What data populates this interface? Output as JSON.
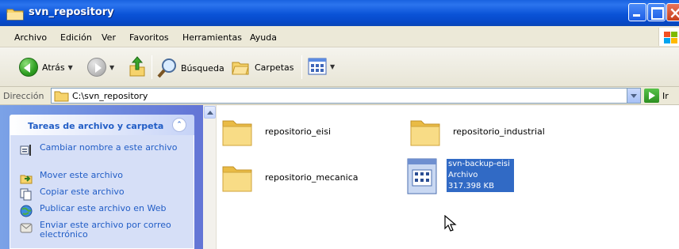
{
  "window": {
    "title": "svn_repository"
  },
  "menu": {
    "items": [
      "Archivo",
      "Edición",
      "Ver",
      "Favoritos",
      "Herramientas",
      "Ayuda"
    ]
  },
  "toolbar": {
    "back_label": "Atrás",
    "search_label": "Búsqueda",
    "folders_label": "Carpetas"
  },
  "address": {
    "label": "Dirección",
    "path": "C:\\svn_repository",
    "go_label": "Ir"
  },
  "tasks": {
    "header": "Tareas de archivo y carpeta",
    "items": [
      {
        "label": "Cambiar nombre a este archivo",
        "icon": "rename-icon"
      },
      {
        "label": "Mover este archivo",
        "icon": "move-icon"
      },
      {
        "label": "Copiar este archivo",
        "icon": "copy-icon"
      },
      {
        "label": "Publicar este archivo en Web",
        "icon": "web-publish-icon"
      },
      {
        "label": "Enviar este archivo por correo electrónico",
        "icon": "email-icon"
      }
    ]
  },
  "files": [
    {
      "name": "repositorio_eisi",
      "type": "folder"
    },
    {
      "name": "repositorio_industrial",
      "type": "folder"
    },
    {
      "name": "repositorio_mecanica",
      "type": "folder"
    },
    {
      "name": "svn-backup-eisi",
      "type": "Archivo",
      "size": "317.398 KB",
      "selected": true
    }
  ],
  "colors": {
    "titlebar": "#0a53d7",
    "selection": "#316ac5",
    "task_link": "#215dc6",
    "folder": "#f5d77f"
  }
}
